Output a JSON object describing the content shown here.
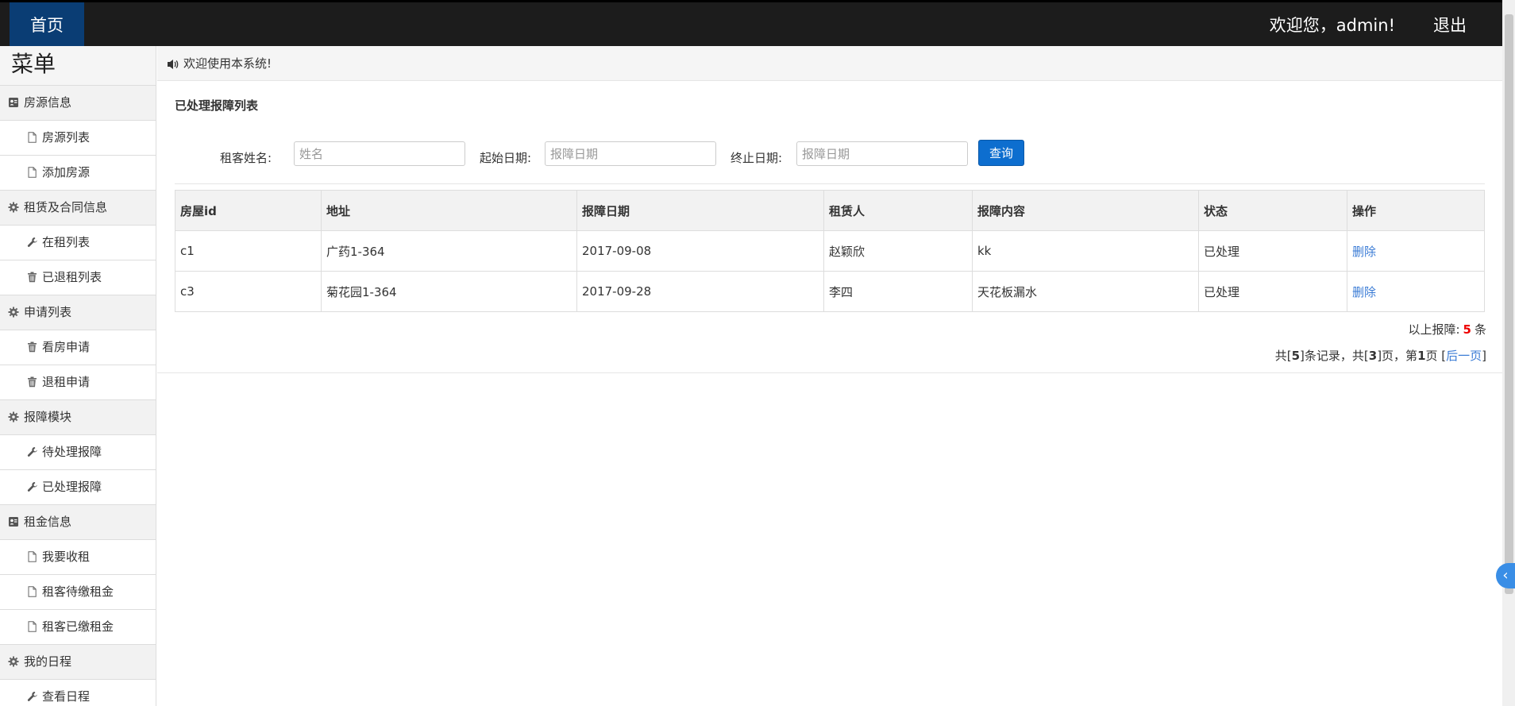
{
  "topbar": {
    "home": "首页",
    "welcome": "欢迎您，admin!",
    "logout": "退出"
  },
  "sidebar": {
    "title": "菜单",
    "groups": [
      {
        "label": "房源信息",
        "icon": "contact-card-icon",
        "items": [
          {
            "label": "房源列表",
            "icon": "file-icon"
          },
          {
            "label": "添加房源",
            "icon": "file-icon"
          }
        ]
      },
      {
        "label": "租赁及合同信息",
        "icon": "gear-icon",
        "items": [
          {
            "label": "在租列表",
            "icon": "wrench-icon"
          },
          {
            "label": "已退租列表",
            "icon": "trash-icon"
          }
        ]
      },
      {
        "label": "申请列表",
        "icon": "gear-icon",
        "items": [
          {
            "label": "看房申请",
            "icon": "trash-icon"
          },
          {
            "label": "退租申请",
            "icon": "trash-icon"
          }
        ]
      },
      {
        "label": "报障模块",
        "icon": "gear-icon",
        "items": [
          {
            "label": "待处理报障",
            "icon": "wrench-icon"
          },
          {
            "label": "已处理报障",
            "icon": "wrench-icon"
          }
        ]
      },
      {
        "label": "租金信息",
        "icon": "contact-card-icon",
        "items": [
          {
            "label": "我要收租",
            "icon": "file-icon"
          },
          {
            "label": "租客待缴租金",
            "icon": "file-icon"
          },
          {
            "label": "租客已缴租金",
            "icon": "file-icon"
          }
        ]
      },
      {
        "label": "我的日程",
        "icon": "gear-icon",
        "items": [
          {
            "label": "查看日程",
            "icon": "wrench-icon"
          }
        ]
      }
    ]
  },
  "notice": {
    "text": "欢迎使用本系统!",
    "icon": "speaker-icon"
  },
  "main": {
    "title": "已处理报障列表",
    "filter": {
      "name_label": "租客姓名:",
      "name_placeholder": "姓名",
      "start_label": "起始日期:",
      "start_placeholder": "报障日期",
      "end_label": "终止日期:",
      "end_placeholder": "报障日期",
      "query_button": "查询"
    },
    "table": {
      "headers": [
        "房屋id",
        "地址",
        "报障日期",
        "租赁人",
        "报障内容",
        "状态",
        "操作"
      ],
      "rows": [
        [
          "c1",
          "广药1-364",
          "2017-09-08",
          "赵颖欣",
          "kk",
          "已处理",
          "删除"
        ],
        [
          "c3",
          "菊花园1-364",
          "2017-09-28",
          "李四",
          "天花板漏水",
          "已处理",
          "删除"
        ]
      ]
    },
    "summary": {
      "prefix": "以上报障:",
      "count": "5",
      "suffix": "条"
    },
    "pager": {
      "p1": "共[",
      "total_records": "5",
      "p2": "]条记录，共[",
      "total_pages": "3",
      "p3": "]页，第",
      "current_page": "1",
      "p4": "页 [",
      "next": "后一页",
      "p5": "]"
    }
  },
  "sidetab": {
    "icon": "chevron-left-icon",
    "glyph": "‹"
  },
  "colors": {
    "topbar": "#1c1c1c",
    "home": "#0a3d74",
    "accent": "#0d6ecf",
    "link": "#3a7bd5",
    "count": "#e00000"
  }
}
